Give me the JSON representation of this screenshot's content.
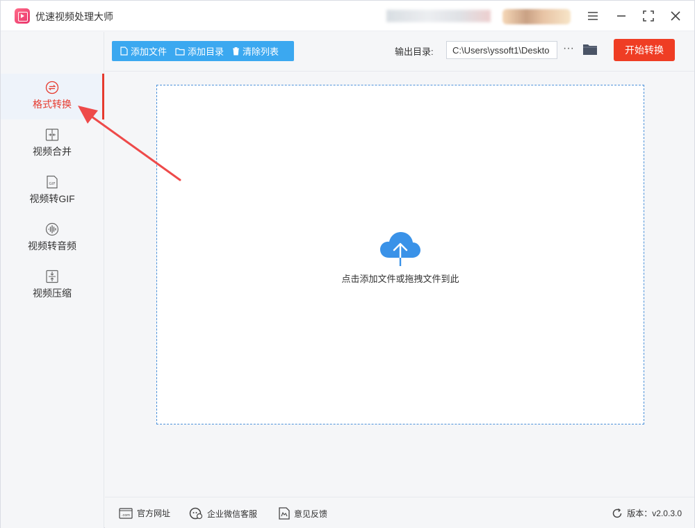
{
  "app": {
    "title": "优速视频处理大师"
  },
  "window_controls": {
    "menu": "≡",
    "minimize": "—",
    "maximize": "⛶",
    "close": "✕"
  },
  "sidebar": {
    "items": [
      {
        "label": "格式转换",
        "icon": "format-convert-icon",
        "active": true
      },
      {
        "label": "视频合并",
        "icon": "video-merge-icon",
        "active": false
      },
      {
        "label": "视频转GIF",
        "icon": "gif-icon",
        "active": false
      },
      {
        "label": "视频转音频",
        "icon": "audio-icon",
        "active": false
      },
      {
        "label": "视频压缩",
        "icon": "compress-icon",
        "active": false
      }
    ]
  },
  "toolbar": {
    "add_file": "添加文件",
    "add_folder": "添加目录",
    "clear_list": "清除列表",
    "output_label": "输出目录:",
    "output_path": "C:\\Users\\yssoft1\\Deskto",
    "more": "···",
    "start": "开始转换"
  },
  "dropzone": {
    "text": "点击添加文件或拖拽文件到此"
  },
  "footer": {
    "website": "官方网址",
    "wechat": "企业微信客服",
    "feedback": "意见反馈",
    "version": "版本：v2.0.3.0"
  },
  "colors": {
    "accent": "#3ba8f0",
    "danger": "#ef3d24",
    "active_text": "#e63a2e",
    "annotation": "#ee4a4a"
  }
}
